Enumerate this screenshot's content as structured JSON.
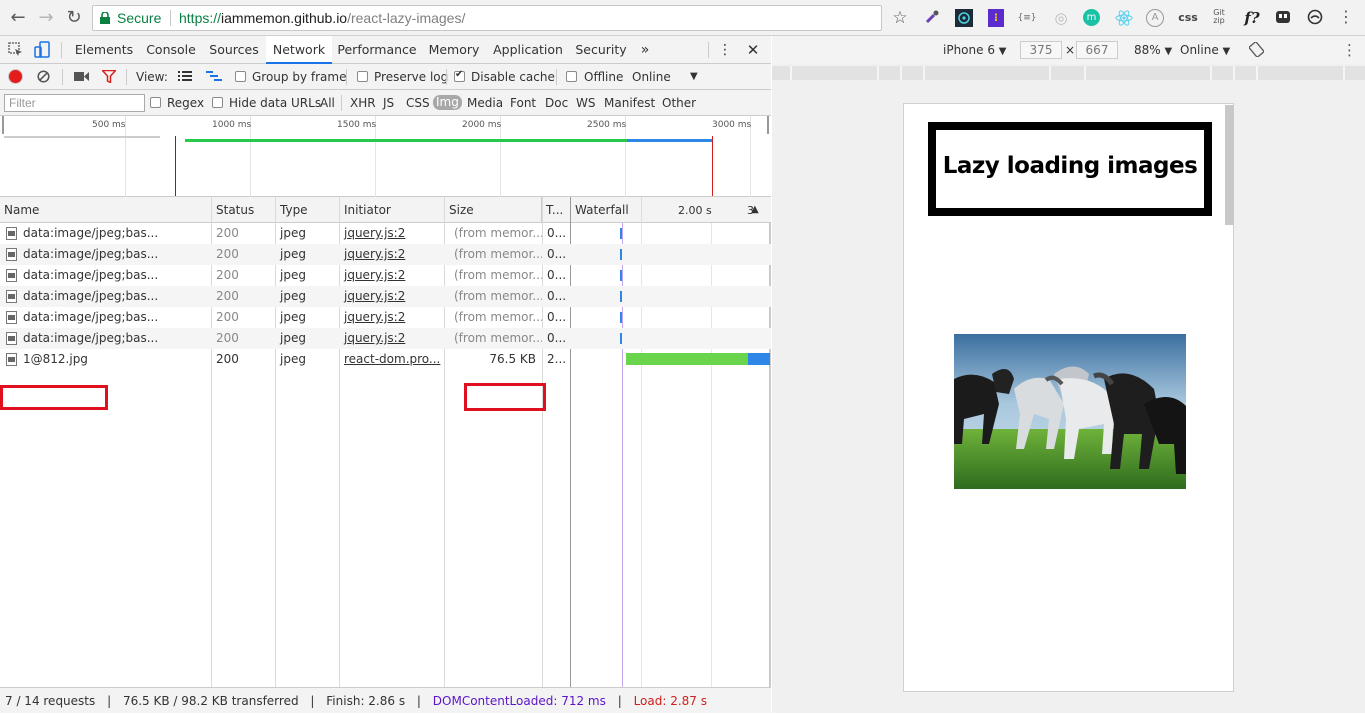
{
  "browser": {
    "secure_label": "Secure",
    "url_protocol": "https://",
    "url_host": "iammemon.github.io",
    "url_path": "/react-lazy-images/",
    "extensions": [
      "star-icon",
      "eyedropper-icon",
      "robot-icon",
      "pocket-icon",
      "braces-icon",
      "refresh-circle-icon",
      "m-icon",
      "react-icon",
      "a-icon",
      "css-icon",
      "gitzip-icon",
      "f?-icon",
      "ghost-icon",
      "octo-icon",
      "menu-icon"
    ],
    "ext_labels": {
      "braces": "{≡}",
      "css": "css",
      "gitzip_top": "Git",
      "gitzip_bottom": "zip",
      "fq": "f?"
    }
  },
  "devtools": {
    "tabs": [
      "Elements",
      "Console",
      "Sources",
      "Network",
      "Performance",
      "Memory",
      "Application",
      "Security"
    ],
    "active_tab": "Network",
    "more_tabs": "»",
    "toolbar": {
      "view_label": "View:",
      "group_by_frame": "Group by frame",
      "preserve_log": "Preserve log",
      "disable_cache": "Disable cache",
      "offline": "Offline",
      "throttle": "Online"
    },
    "filter": {
      "placeholder": "Filter",
      "regex": "Regex",
      "hide_data_urls": "Hide data URLs",
      "types": [
        "All",
        "XHR",
        "JS",
        "CSS",
        "Img",
        "Media",
        "Font",
        "Doc",
        "WS",
        "Manifest",
        "Other"
      ],
      "selected_type": "Img"
    },
    "overview": {
      "ticks": [
        "500 ms",
        "1000 ms",
        "1500 ms",
        "2000 ms",
        "2500 ms",
        "3000 ms"
      ]
    },
    "columns": [
      "Name",
      "Status",
      "Type",
      "Initiator",
      "Size",
      "T...",
      "Waterfall"
    ],
    "waterfall_tick": "2.00 s",
    "waterfall_extra": "3",
    "rows": [
      {
        "name": "data:image/jpeg;bas...",
        "status": "200",
        "type": "jpeg",
        "initiator": "jquery.js:2",
        "size": "(from memor...",
        "time": "0..."
      },
      {
        "name": "data:image/jpeg;bas...",
        "status": "200",
        "type": "jpeg",
        "initiator": "jquery.js:2",
        "size": "(from memor...",
        "time": "0..."
      },
      {
        "name": "data:image/jpeg;bas...",
        "status": "200",
        "type": "jpeg",
        "initiator": "jquery.js:2",
        "size": "(from memor...",
        "time": "0..."
      },
      {
        "name": "data:image/jpeg;bas...",
        "status": "200",
        "type": "jpeg",
        "initiator": "jquery.js:2",
        "size": "(from memor...",
        "time": "0..."
      },
      {
        "name": "data:image/jpeg;bas...",
        "status": "200",
        "type": "jpeg",
        "initiator": "jquery.js:2",
        "size": "(from memor...",
        "time": "0..."
      },
      {
        "name": "data:image/jpeg;bas...",
        "status": "200",
        "type": "jpeg",
        "initiator": "jquery.js:2",
        "size": "(from memor...",
        "time": "0..."
      },
      {
        "name": "1@812.jpg",
        "status": "200",
        "type": "jpeg",
        "initiator": "react-dom.pro...",
        "size": "76.5 KB",
        "time": "2..."
      }
    ],
    "status": {
      "requests": "7 / 14 requests",
      "transferred": "76.5 KB / 98.2 KB transferred",
      "finish": "Finish: 2.86 s",
      "dom_content_loaded": "DOMContentLoaded: 712 ms",
      "load": "Load: 2.87 s",
      "sep": "|"
    }
  },
  "device": {
    "model": "iPhone 6",
    "width": "375",
    "times": "×",
    "height": "667",
    "zoom": "88%",
    "network": "Online",
    "page_title": "Lazy loading images"
  },
  "colors": {
    "record": "#e61c1c",
    "filter_red": "#d92222",
    "dcl": "#5a15c9",
    "load": "#d0201e",
    "highlight": "#e0101e",
    "waterfall_green": "#6ad54c",
    "waterfall_blue": "#2e87e6"
  }
}
